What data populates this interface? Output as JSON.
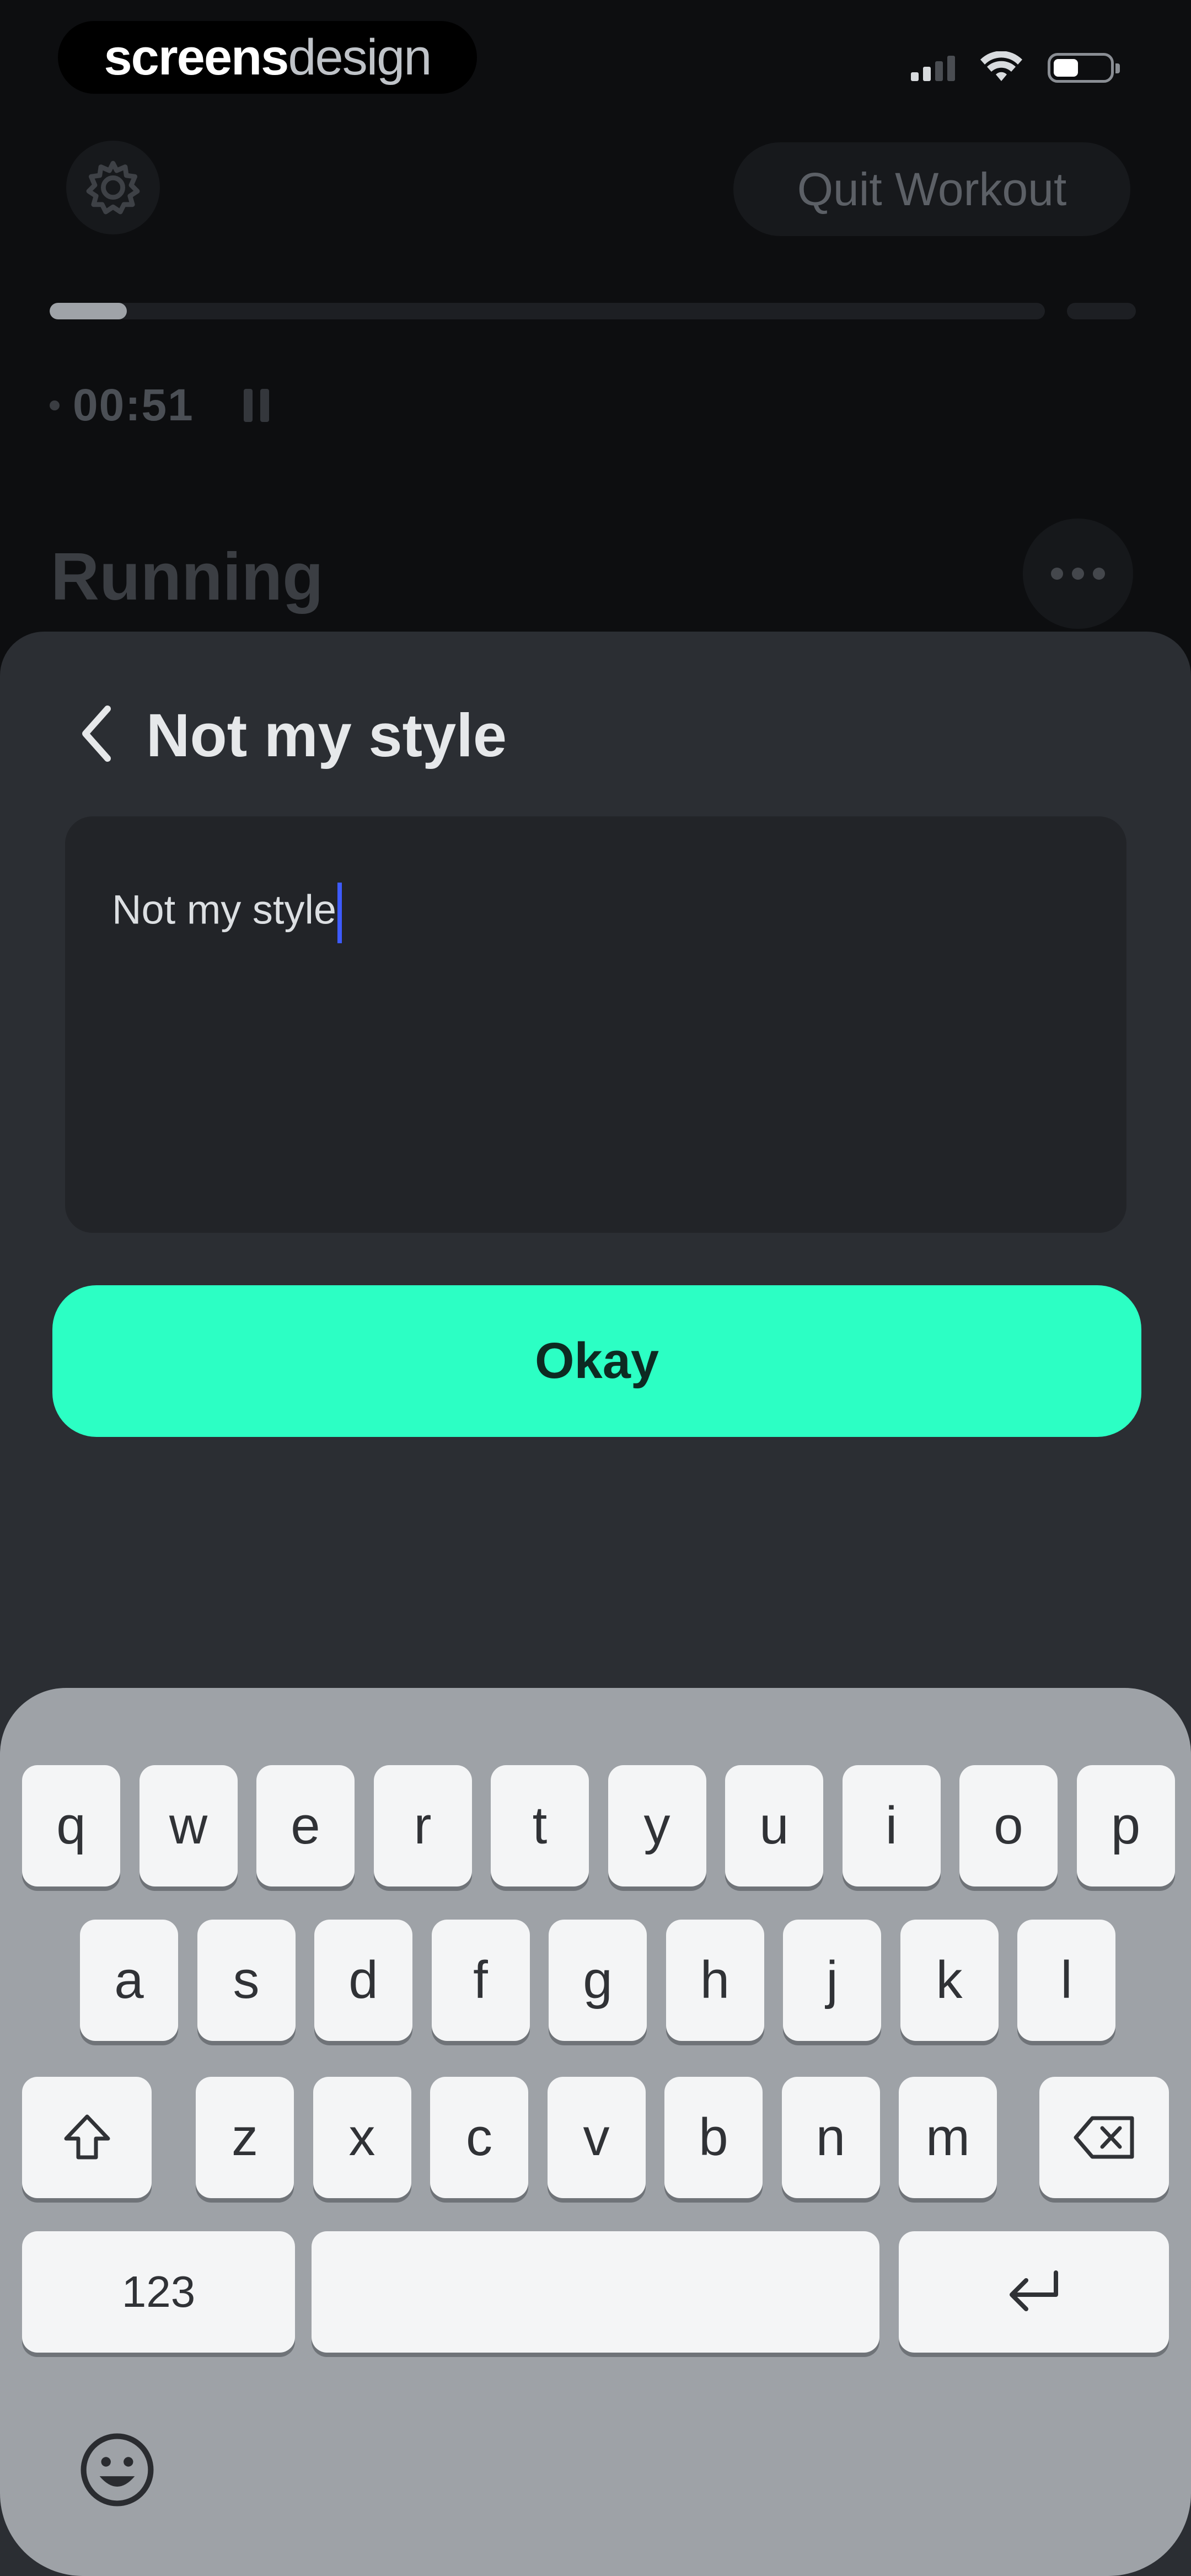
{
  "status_bar": {
    "brand_part1": "screens",
    "brand_part2": "design"
  },
  "header": {
    "settings_icon": "gear-icon",
    "quit_label": "Quit Workout"
  },
  "progress": {
    "fraction": 0.03
  },
  "timer": {
    "elapsed": "00:51",
    "pause_icon": "pause-icon"
  },
  "workout": {
    "title": "Running",
    "more_icon": "more-horizontal-icon"
  },
  "sheet": {
    "back_icon": "chevron-left-icon",
    "title": "Not my style",
    "input_value": "Not my style",
    "okay_label": "Okay"
  },
  "keyboard": {
    "row1": [
      "q",
      "w",
      "e",
      "r",
      "t",
      "y",
      "u",
      "i",
      "o",
      "p"
    ],
    "row2": [
      "a",
      "s",
      "d",
      "f",
      "g",
      "h",
      "j",
      "k",
      "l"
    ],
    "row3": [
      "z",
      "x",
      "c",
      "v",
      "b",
      "n",
      "m"
    ],
    "numbers_label": "123",
    "shift_icon": "shift-icon",
    "delete_icon": "backspace-icon",
    "return_icon": "return-icon",
    "emoji_icon": "emoji-icon"
  },
  "colors": {
    "accent": "#2cffc4",
    "background": "#0d0e10",
    "sheet": "#2b2e33",
    "caret": "#3d5bff"
  }
}
